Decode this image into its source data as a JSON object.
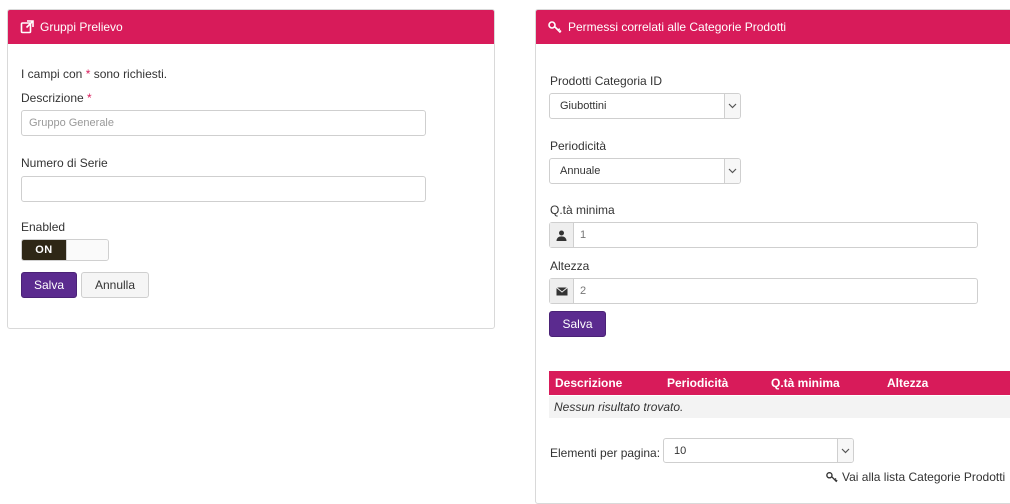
{
  "left_panel": {
    "title": "Gruppi Prelievo",
    "required_note_prefix": "I campi con ",
    "required_note_star": "*",
    "required_note_suffix": " sono richiesti.",
    "descrizione_label": "Descrizione",
    "descrizione_star": "*",
    "descrizione_placeholder": "Gruppo Generale",
    "numero_serie_label": "Numero di Serie",
    "numero_serie_value": "",
    "enabled_label": "Enabled",
    "toggle_on_label": "ON",
    "save_label": "Salva",
    "cancel_label": "Annulla"
  },
  "right_panel": {
    "title": "Permessi correlati alle Categorie Prodotti",
    "categoria_label": "Prodotti Categoria ID",
    "categoria_value": "Giubottini",
    "periodicita_label": "Periodicità",
    "periodicita_value": "Annuale",
    "qta_label": "Q.tà minima",
    "qta_placeholder": "1",
    "altezza_label": "Altezza",
    "altezza_placeholder": "2",
    "save_label": "Salva",
    "table": {
      "headers": [
        "Descrizione",
        "Periodicità",
        "Q.tà minima",
        "Altezza"
      ],
      "empty_message": "Nessun risultato trovato."
    },
    "per_page_label": "Elementi per pagina:",
    "per_page_value": "10",
    "list_link": "Vai alla lista Categorie Prodotti"
  },
  "icons": {
    "left_header": "external-link-icon",
    "right_header": "key-icon",
    "qta_addon": "user-icon",
    "altezza_addon": "envelope-icon",
    "list_link": "key-icon"
  },
  "colors": {
    "header_bg": "#d81b5a",
    "primary_button": "#5b2b8f",
    "toggle_on": "#2e2716"
  }
}
